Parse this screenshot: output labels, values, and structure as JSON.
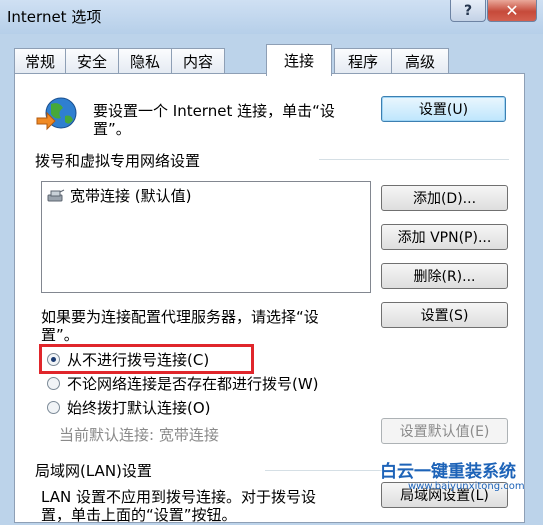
{
  "window": {
    "title": "Internet 选项",
    "help": "?",
    "close": "✕"
  },
  "tabs": [
    "常规",
    "安全",
    "隐私",
    "内容",
    "连接",
    "程序",
    "高级"
  ],
  "connection": {
    "intro_line1": "要设置一个 Internet 连接，单击“设",
    "intro_line2": "置”。",
    "setup_button": "设置(U)"
  },
  "dialup": {
    "section_label": "拨号和虚拟专用网络设置",
    "items": [
      "宽带连接 (默认值)"
    ],
    "add_button": "添加(D)...",
    "add_vpn_button": "添加 VPN(P)...",
    "delete_button": "删除(R)...",
    "proxy_text_line1": "如果要为连接配置代理服务器，请选择“设",
    "proxy_text_line2": "置”。",
    "settings_button": "设置(S)",
    "options": [
      {
        "label": "从不进行拨号连接(C)",
        "selected": true
      },
      {
        "label": "不论网络连接是否存在都进行拨号(W)",
        "selected": false
      },
      {
        "label": "始终拨打默认连接(O)",
        "selected": false
      }
    ],
    "current_default": "当前默认连接: 宽带连接",
    "set_default_button": "设置默认值(E)"
  },
  "lan": {
    "section_label": "局域网(LAN)设置",
    "text_line1": "LAN 设置不应用到拨号连接。对于拨号设",
    "text_line2": "置，单击上面的“设置”按钮。",
    "lan_button": "局域网设置(L)"
  },
  "watermark": {
    "text": "白云一键重装系统",
    "url": "www.baiyunxitong.com"
  }
}
